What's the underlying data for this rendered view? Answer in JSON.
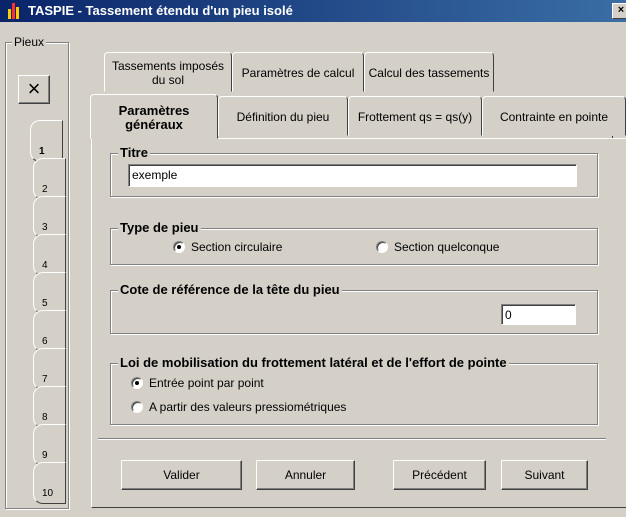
{
  "window": {
    "title": "TASPIE - Tassement étendu d'un pieu isolé",
    "close_label": "×",
    "colors": {
      "titlebar": "#0a246a",
      "face": "#d4d0c8"
    }
  },
  "pieux": {
    "label": "Pieux",
    "delete_label": "×",
    "tabs": [
      "1",
      "2",
      "3",
      "4",
      "5",
      "6",
      "7",
      "8",
      "9",
      "10"
    ],
    "selected": "1"
  },
  "tabs": {
    "row1": [
      {
        "label": "Tassements imposés du sol"
      },
      {
        "label": "Paramètres de calcul"
      },
      {
        "label": "Calcul des tassements"
      }
    ],
    "row2": [
      {
        "label": "Paramètres généraux",
        "active": true
      },
      {
        "label": "Définition du pieu"
      },
      {
        "label": "Frottement qs = qs(y)"
      },
      {
        "label": "Contrainte en pointe"
      }
    ]
  },
  "titre": {
    "label": "Titre",
    "value": "exemple"
  },
  "type_pieu": {
    "label": "Type de pieu",
    "options": [
      "Section circulaire",
      "Section quelconque"
    ],
    "selected": "Section circulaire"
  },
  "cote": {
    "label": "Cote de référence de la tête du pieu",
    "value": "0"
  },
  "loi": {
    "label": "Loi de mobilisation du frottement latéral et de l'effort de pointe",
    "options": [
      "Entrée point par point",
      "A partir des valeurs pressiométriques"
    ],
    "selected": "Entrée point par point"
  },
  "buttons": {
    "valider": "Valider",
    "annuler": "Annuler",
    "precedent": "Précédent",
    "suivant": "Suivant"
  }
}
